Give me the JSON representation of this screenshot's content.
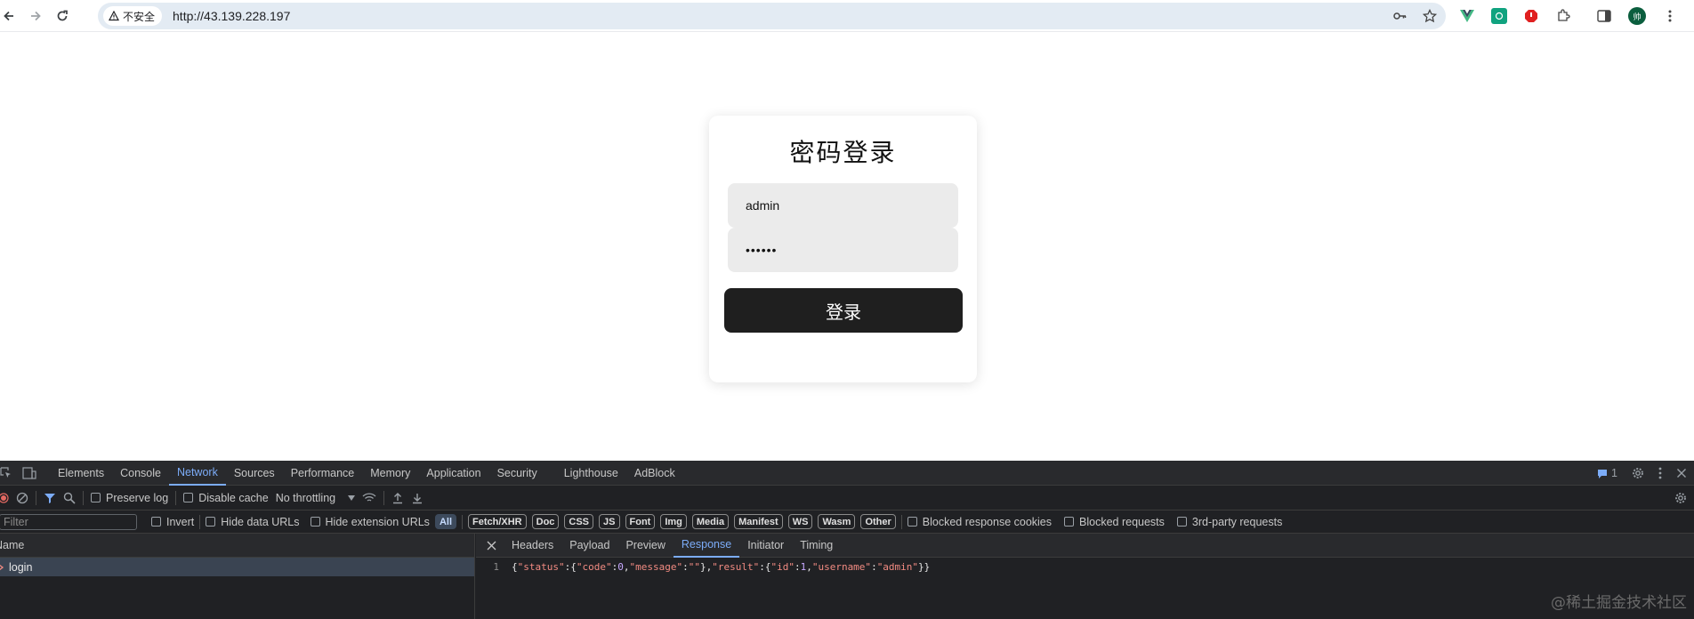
{
  "browser": {
    "security_label": "不安全",
    "url": "http://43.139.228.197",
    "avatar_text": "帅"
  },
  "login": {
    "title": "密码登录",
    "username_value": "admin",
    "password_value": "••••••",
    "submit_label": "登录"
  },
  "devtools": {
    "tabs": [
      "Elements",
      "Console",
      "Network",
      "Sources",
      "Performance",
      "Memory",
      "Application",
      "Security",
      "Lighthouse",
      "AdBlock"
    ],
    "active_tab": "Network",
    "issues_count": "1",
    "preserve_log": "Preserve log",
    "disable_cache": "Disable cache",
    "throttling": "No throttling",
    "filter_placeholder": "Filter",
    "invert": "Invert",
    "hide_data_urls": "Hide data URLs",
    "hide_extension_urls": "Hide extension URLs",
    "type_filters": [
      "All",
      "Fetch/XHR",
      "Doc",
      "CSS",
      "JS",
      "Font",
      "Img",
      "Media",
      "Manifest",
      "WS",
      "Wasm",
      "Other"
    ],
    "blocked_cookies": "Blocked response cookies",
    "blocked_requests": "Blocked requests",
    "third_party": "3rd-party requests",
    "name_header": "Name",
    "request_name": "login",
    "detail_tabs": [
      "Headers",
      "Payload",
      "Preview",
      "Response",
      "Initiator",
      "Timing"
    ],
    "active_detail_tab": "Response",
    "response_line_number": "1",
    "response_body": "{\"status\":{\"code\":0,\"message\":\"\"},\"result\":{\"id\":1,\"username\":\"admin\"}}"
  },
  "watermark": "@稀土掘金技术社区",
  "colors": {
    "button_bg": "#1f1f1f",
    "devtools_bg": "#202124",
    "active_tab": "#7cacf8"
  }
}
